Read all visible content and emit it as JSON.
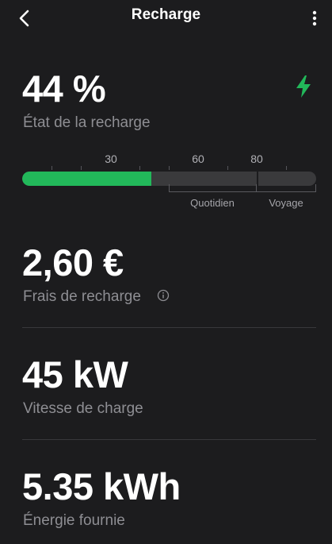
{
  "header": {
    "title": "Recharge"
  },
  "icons": {
    "back": "chevron-left-icon",
    "menu": "more-vertical-icon",
    "bolt": "lightning-bolt-icon",
    "info": "info-circle-icon"
  },
  "colors": {
    "background": "#1c1c1e",
    "accent_green": "#22b85a",
    "track": "#3a3a3c",
    "secondary_text": "#8e8e93"
  },
  "charge": {
    "value": "44 %",
    "label": "État de la recharge",
    "level_percent": 44,
    "limit_percent": 80,
    "ticks": [
      "30",
      "60",
      "80"
    ],
    "ranges": [
      "Quotidien",
      "Voyage"
    ]
  },
  "cost": {
    "value": "2,60 €",
    "label": "Frais de recharge"
  },
  "speed": {
    "value": "45 kW",
    "label": "Vitesse de charge"
  },
  "energy": {
    "value": "5.35 kWh",
    "label": "Énergie fournie"
  }
}
